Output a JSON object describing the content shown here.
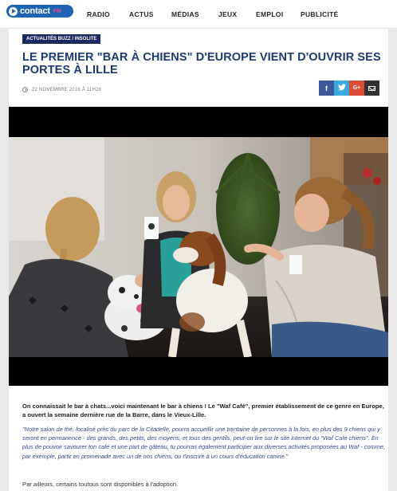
{
  "brand": {
    "logo_text": "contact",
    "logo_suffix": "FM"
  },
  "nav": {
    "items": [
      "RADIO",
      "ACTUS",
      "MÉDIAS",
      "JEUX",
      "EMPLOI",
      "PUBLICITÉ"
    ]
  },
  "article": {
    "category": "ACTUALITÉS BUZZ / INSOLITE",
    "title": "LE PREMIER \"BAR À CHIENS\" D'EUROPE VIENT D'OUVRIR SES PORTES À LILLE",
    "date": "22 NOVEMBRE 2016 À 11H28",
    "share": {
      "facebook": "f",
      "twitter": "t",
      "google": "G+",
      "email": "email"
    },
    "intro": "On connaissait le bar à chats...voici maintenant le bar à chiens ! Le \"Waf Café\", premier établissement de ce genre en Europe, a ouvert la semaine dernière rue de la Barre, dans le Vieux-Lille.",
    "quote": "\"Notre salon de thé, localisé près du parc de la Citadelle, pourra accueillir une trentaine de personnes à la fois, en plus des 9 chiens qui y seront en permanence - des grands, des petits, des moyens, et tous des gentils, peut-on lire sur le site internet du \"Waf Café chiens\". En plus de pouvoir savourer ton café et une part de gâteau, tu pourras également participer aux diverses activités proposées au Waf - comme, par exemple, partir en promenade avec un de nos chiens, ou t'inscrire à un cours d'éducation canine.\"",
    "footer": "Par ailleurs, certains toutous sont disponibles à l'adoption."
  },
  "colors": {
    "navy": "#1b3b6e",
    "category_bg": "#1a2a5e",
    "facebook": "#3b5998",
    "twitter": "#39a9e0",
    "google": "#dd4b39",
    "email": "#333333",
    "quote": "#334a8a"
  }
}
